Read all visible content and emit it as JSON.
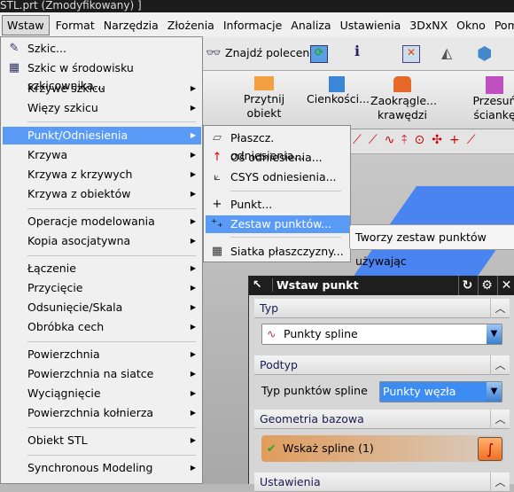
{
  "window": {
    "title": "STL.prt (Zmodyfikowany) ]"
  },
  "menubar": [
    "Wstaw",
    "Format",
    "Narzędzia",
    "Złożenia",
    "Informacje",
    "Analiza",
    "Ustawienia",
    "3DxNX",
    "Okno",
    "Pomoc"
  ],
  "toolbar": {
    "find_command": "Znajdź polecenie",
    "przytnij": "Przytnij",
    "obiekt": "obiekt",
    "cienkosci": "Cienkości...",
    "zaokragle": "Zaokrągle...",
    "krawedzi": "krawędzi",
    "przesun": "Przesuń",
    "scianke": "ściankę"
  },
  "insert_menu": {
    "items": [
      {
        "label": "Szkic...",
        "icon": "sketch-icon",
        "submenu": false
      },
      {
        "label": "Szkic w środowisku szkicownika...",
        "icon": "sketch-task-icon",
        "submenu": false
      },
      {
        "label": "Krzywe szkicu",
        "submenu": true
      },
      {
        "label": "Więzy szkicu",
        "submenu": true
      },
      {
        "label": "Punkt/Odniesienia",
        "submenu": true,
        "highlighted": true
      },
      {
        "label": "Krzywa",
        "submenu": true
      },
      {
        "label": "Krzywa z krzywych",
        "submenu": true
      },
      {
        "label": "Krzywa z obiektów",
        "submenu": true
      },
      {
        "label": "Operacje modelowania",
        "submenu": true
      },
      {
        "label": "Kopia asocjatywna",
        "submenu": true
      },
      {
        "label": "Łączenie",
        "submenu": true
      },
      {
        "label": "Przycięcie",
        "submenu": true
      },
      {
        "label": "Odsunięcie/Skala",
        "submenu": true
      },
      {
        "label": "Obróbka cech",
        "submenu": true
      },
      {
        "label": "Powierzchnia",
        "submenu": true
      },
      {
        "label": "Powierzchnia na siatce",
        "submenu": true
      },
      {
        "label": "Wyciągnięcie",
        "submenu": true
      },
      {
        "label": "Powierzchnia kołnierza",
        "submenu": true
      },
      {
        "label": "Obiekt STL",
        "submenu": true
      },
      {
        "label": "Synchronous Modeling",
        "submenu": true
      }
    ]
  },
  "submenu": {
    "items": [
      {
        "label": "Płaszcz. odniesienia...",
        "icon": "datum-plane-icon"
      },
      {
        "label": "Oś odniesienia...",
        "icon": "datum-axis-icon"
      },
      {
        "label": "CSYS odniesienia...",
        "icon": "datum-csys-icon"
      },
      {
        "label": "Punkt...",
        "icon": "point-icon"
      },
      {
        "label": "Zestaw punktów...",
        "icon": "point-set-icon",
        "highlighted": true
      },
      {
        "label": "Siatka płaszczyzny...",
        "icon": "raster-plane-icon"
      }
    ]
  },
  "tooltip": "Tworzy zestaw punktów używając",
  "dialog": {
    "title": "Wstaw punkt",
    "sections": {
      "typ": "Typ",
      "podtyp": "Podtyp",
      "geometria": "Geometria bazowa",
      "ustawienia": "Ustawienia"
    },
    "type_value": "Punkty spline",
    "subtype_label": "Typ punktów spline",
    "subtype_value": "Punkty węzła",
    "select_spline": "Wskaż spline (1)"
  },
  "colors": {
    "highlight": "#5b9bf8",
    "selection_bar": "#e0a060",
    "viewport_plane": "#4a84f0"
  }
}
